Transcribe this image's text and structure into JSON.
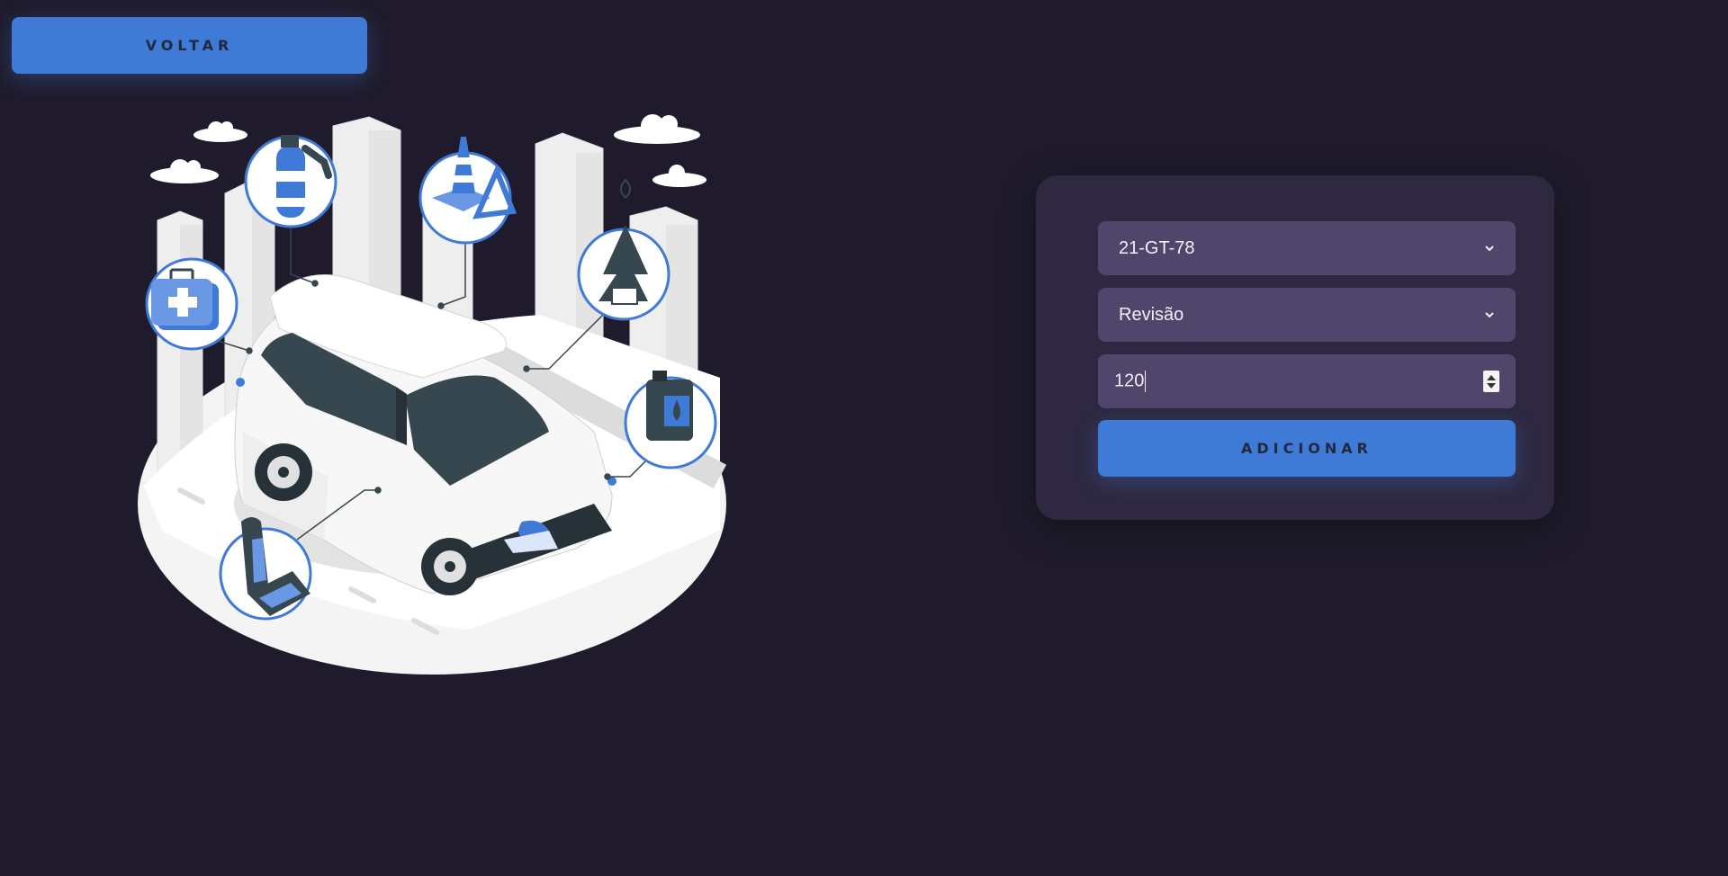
{
  "header": {
    "back_label": "VOLTAR"
  },
  "form": {
    "plate_select": {
      "value": "21-GT-78"
    },
    "service_select": {
      "value": "Revisão"
    },
    "amount_input": {
      "value": "120"
    },
    "add_label": "ADICIONAR"
  },
  "colors": {
    "background": "#1f1b2c",
    "card": "#2e2840",
    "field": "#50456b",
    "accent": "#3f7ad6"
  },
  "icons": [
    "chevron-down-icon",
    "stepper-icon",
    "first-aid-kit-icon",
    "fire-extinguisher-icon",
    "traffic-cone-icon",
    "air-freshener-icon",
    "oil-canister-icon",
    "car-seat-icon"
  ]
}
